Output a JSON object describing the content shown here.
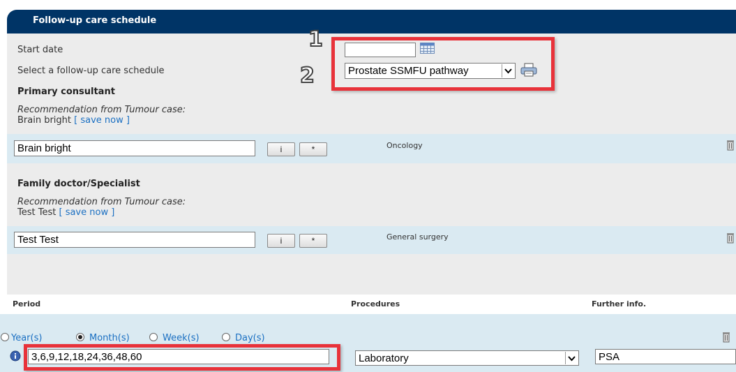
{
  "header": {
    "title": "Follow-up care schedule"
  },
  "schedule": {
    "start_date_label": "Start date",
    "start_date_value": "",
    "select_label": "Select a follow-up care schedule",
    "select_value": "Prostate SSMFU pathway",
    "callout_1": "1",
    "callout_2": "2"
  },
  "primary": {
    "heading": "Primary consultant",
    "recommendation_label": "Recommendation from Tumour case:",
    "recommendation_name": "Brain bright",
    "save_now": "[ save now ]",
    "input_value": "Brain bright",
    "btn_i": "i",
    "btn_star": "*",
    "specialty": "Oncology"
  },
  "family": {
    "heading": "Family doctor/Specialist",
    "recommendation_label": "Recommendation from Tumour case:",
    "recommendation_name": "Test Test",
    "save_now": "[ save now ]",
    "input_value": "Test Test",
    "btn_i": "i",
    "btn_star": "*",
    "specialty": "General surgery"
  },
  "table": {
    "col_period": "Period",
    "col_procedures": "Procedures",
    "col_further": "Further info.",
    "radios": [
      {
        "label": "Year(s)",
        "checked": false
      },
      {
        "label": "Month(s)",
        "checked": true
      },
      {
        "label": "Week(s)",
        "checked": false
      },
      {
        "label": "Day(s)",
        "checked": false
      }
    ],
    "period_value": "3,6,9,12,18,24,36,48,60",
    "procedure_value": "Laboratory",
    "further_value": "PSA"
  },
  "colors": {
    "header_bg": "#003466",
    "callout_red": "#e8323a",
    "link_blue": "#1a6fc2"
  }
}
